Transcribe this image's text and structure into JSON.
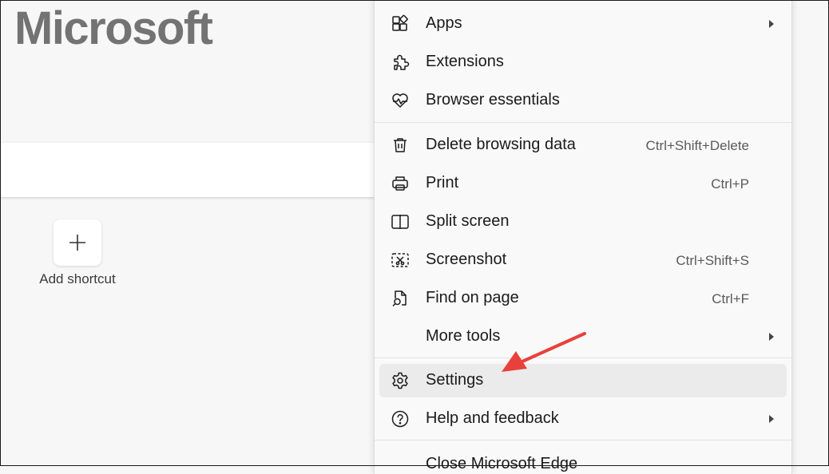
{
  "page": {
    "brand": "Microsoft",
    "add_shortcut_label": "Add shortcut"
  },
  "menu": {
    "items": [
      {
        "label": "Apps",
        "icon": "apps-icon",
        "submenu": true
      },
      {
        "label": "Extensions",
        "icon": "extensions-icon"
      },
      {
        "label": "Browser essentials",
        "icon": "browser-essentials-icon"
      },
      {
        "label": "Delete browsing data",
        "icon": "trash-icon",
        "shortcut": "Ctrl+Shift+Delete"
      },
      {
        "label": "Print",
        "icon": "print-icon",
        "shortcut": "Ctrl+P"
      },
      {
        "label": "Split screen",
        "icon": "split-screen-icon"
      },
      {
        "label": "Screenshot",
        "icon": "screenshot-icon",
        "shortcut": "Ctrl+Shift+S"
      },
      {
        "label": "Find on page",
        "icon": "find-on-page-icon",
        "shortcut": "Ctrl+F"
      },
      {
        "label": "More tools",
        "submenu": true
      },
      {
        "label": "Settings",
        "icon": "settings-icon",
        "highlighted": true
      },
      {
        "label": "Help and feedback",
        "icon": "help-icon",
        "submenu": true
      },
      {
        "label": "Close Microsoft Edge"
      }
    ]
  },
  "annotation": {
    "arrow_color": "#e8413b",
    "points_to": "Settings"
  }
}
